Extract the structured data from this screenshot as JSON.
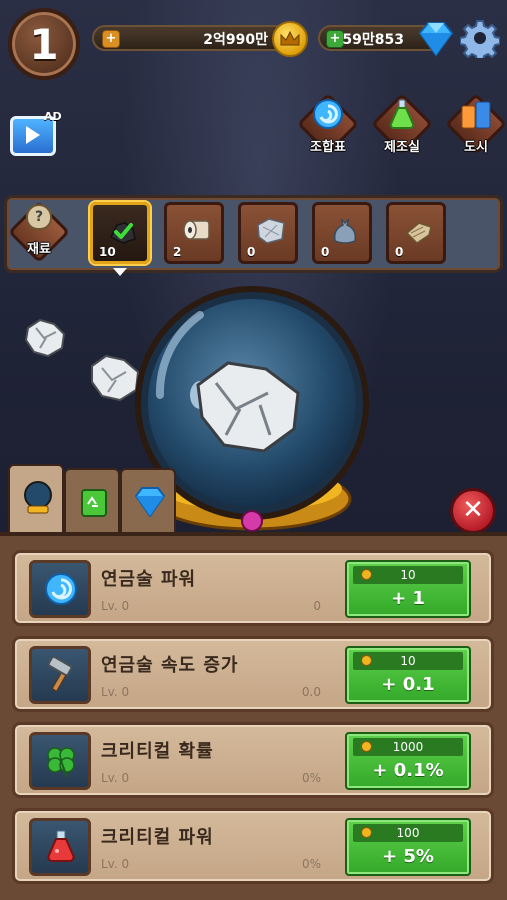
{
  "top_bar": {
    "level": "1",
    "gold_amount": "2억990만",
    "gem_amount": "59만853",
    "gold_plus": "+",
    "gem_plus": "+"
  },
  "ad_button": {
    "badge": "AD"
  },
  "menu": [
    {
      "label": "조합표",
      "icon": "swirl-orb-icon"
    },
    {
      "label": "제조실",
      "icon": "potion-flask-icon"
    },
    {
      "label": "도시",
      "icon": "city-buildings-icon"
    }
  ],
  "materials": {
    "label": "재료",
    "items": [
      {
        "name": "coal",
        "count": "10",
        "selected": true
      },
      {
        "name": "paper-roll",
        "count": "2",
        "selected": false
      },
      {
        "name": "aluminum-foil",
        "count": "0",
        "selected": false
      },
      {
        "name": "trash-bag",
        "count": "0",
        "selected": false
      },
      {
        "name": "cardboard",
        "count": "0",
        "selected": false
      }
    ]
  },
  "tabs": [
    {
      "name": "orb",
      "active": true
    },
    {
      "name": "recycle",
      "active": false
    },
    {
      "name": "gem",
      "active": false
    }
  ],
  "upgrades": [
    {
      "title": "연금술 파워",
      "level": "Lv. 0",
      "current": "0",
      "cost": "10",
      "gain": "+ 1",
      "icon": "swirl-orb-icon"
    },
    {
      "title": "연금술 속도 증가",
      "level": "Lv. 0",
      "current": "0.0",
      "cost": "10",
      "gain": "+ 0.1",
      "icon": "hammer-icon"
    },
    {
      "title": "크리티컬 확률",
      "level": "Lv. 0",
      "current": "0%",
      "cost": "1000",
      "gain": "+ 0.1%",
      "icon": "clover-icon"
    },
    {
      "title": "크리티컬 파워",
      "level": "Lv. 0",
      "current": "0%",
      "cost": "100",
      "gain": "+ 5%",
      "icon": "red-potion-icon"
    }
  ],
  "colors": {
    "buy_green": "#33a82a",
    "panel_brown": "#6a4a34",
    "close_red": "#b81e2a",
    "gold": "#f2b522"
  }
}
